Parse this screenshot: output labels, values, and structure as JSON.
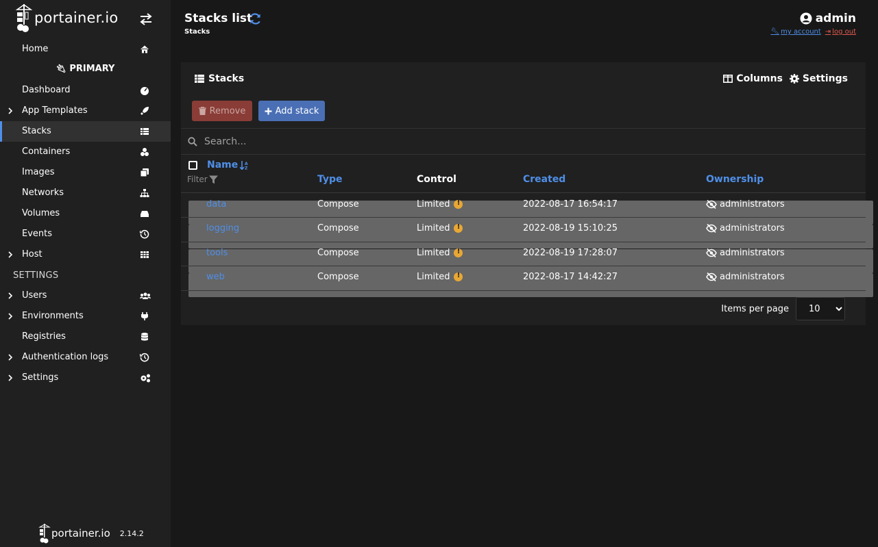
{
  "brand": {
    "name": "portainer.io",
    "version": "2.14.2"
  },
  "sidebar": {
    "items": [
      {
        "label": "Home",
        "icon": "home-icon"
      },
      {
        "label": "Dashboard",
        "icon": "dashboard-icon"
      },
      {
        "label": "App Templates",
        "icon": "rocket-icon"
      },
      {
        "label": "Stacks",
        "icon": "list-icon"
      },
      {
        "label": "Containers",
        "icon": "cubes-icon"
      },
      {
        "label": "Images",
        "icon": "clone-icon"
      },
      {
        "label": "Networks",
        "icon": "sitemap-icon"
      },
      {
        "label": "Volumes",
        "icon": "hdd-icon"
      },
      {
        "label": "Events",
        "icon": "history-icon"
      },
      {
        "label": "Host",
        "icon": "grid-icon"
      },
      {
        "label": "Users",
        "icon": "users-icon"
      },
      {
        "label": "Environments",
        "icon": "plug-icon"
      },
      {
        "label": "Registries",
        "icon": "database-icon"
      },
      {
        "label": "Authentication logs",
        "icon": "history-icon"
      },
      {
        "label": "Settings",
        "icon": "cogs-icon"
      }
    ],
    "environment_label": "PRIMARY",
    "settings_section": "SETTINGS"
  },
  "header": {
    "title": "Stacks list",
    "breadcrumb": "Stacks",
    "user": "admin",
    "my_account": "my account",
    "log_out": "log out"
  },
  "panel": {
    "title": "Stacks",
    "columns_label": "Columns",
    "settings_label": "Settings",
    "remove_label": "Remove",
    "add_label": "Add stack",
    "search_placeholder": "Search...",
    "filter_label": "Filter",
    "headers": {
      "name": "Name",
      "type": "Type",
      "control": "Control",
      "created": "Created",
      "ownership": "Ownership"
    },
    "rows": [
      {
        "name": "data",
        "type": "Compose",
        "control": "Limited",
        "created": "2022-08-17 16:54:17",
        "ownership": "administrators"
      },
      {
        "name": "logging",
        "type": "Compose",
        "control": "Limited",
        "created": "2022-08-19 15:10:25",
        "ownership": "administrators"
      },
      {
        "name": "tools",
        "type": "Compose",
        "control": "Limited",
        "created": "2022-08-19 17:28:07",
        "ownership": "administrators"
      },
      {
        "name": "web",
        "type": "Compose",
        "control": "Limited",
        "created": "2022-08-17 14:42:27",
        "ownership": "administrators"
      }
    ],
    "items_per_page_label": "Items per page",
    "items_per_page": "10"
  },
  "colors": {
    "accent": "#4f8fe8",
    "danger": "#8a3c36",
    "primary_button": "#4a6fb5",
    "warning": "#e8a735"
  }
}
